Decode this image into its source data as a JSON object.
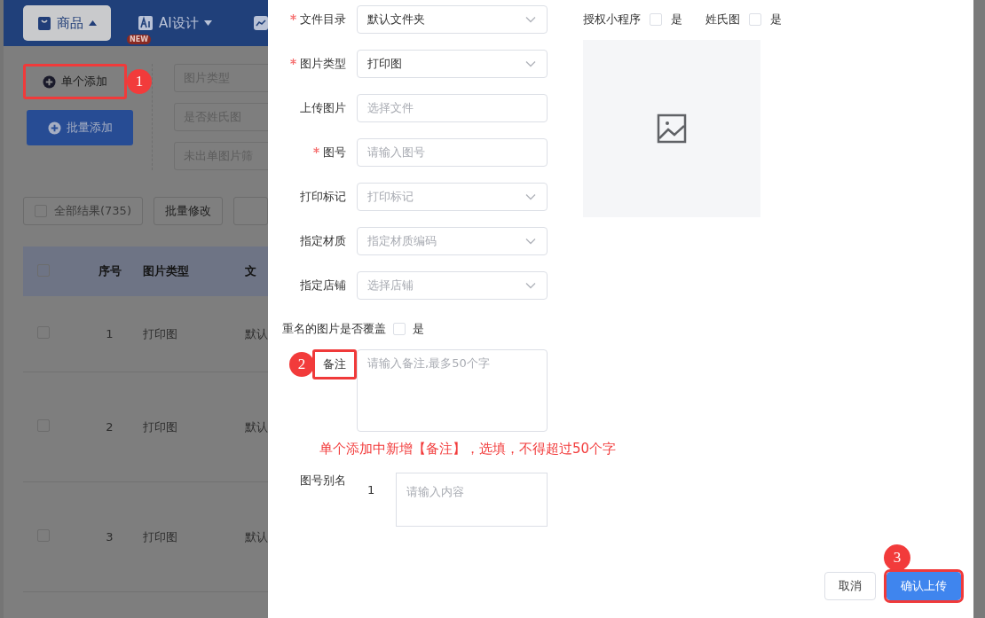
{
  "nav": {
    "tabs": [
      {
        "label": "商品",
        "kind": "bag",
        "selected": true
      },
      {
        "label": "AI设计",
        "kind": "ai",
        "badge": "NEW",
        "selected": false
      },
      {
        "kind": "chart",
        "selected": false
      }
    ]
  },
  "toolbar": {
    "add_single": {
      "label": "单个添加",
      "highlighted": true,
      "marker": "1"
    },
    "add_batch": {
      "label": "批量添加"
    }
  },
  "filters": [
    {
      "placeholder": "图片类型"
    },
    {
      "placeholder": "是否姓氏图"
    },
    {
      "placeholder": "未出单图片筛"
    }
  ],
  "actions": {
    "select_all": {
      "label": "全部结果(735)",
      "checked": false
    },
    "buttons": [
      "批量修改"
    ]
  },
  "table": {
    "header_checked": false,
    "columns": [
      "序号",
      "图片类型",
      "文"
    ],
    "rows": [
      {
        "checked": false,
        "cells": [
          "1",
          "打印图",
          "默认"
        ]
      },
      {
        "checked": false,
        "cells": [
          "2",
          "打印图",
          "默认"
        ]
      },
      {
        "checked": false,
        "cells": [
          "3",
          "打印图",
          "默认"
        ]
      }
    ]
  },
  "dialog": {
    "fields": [
      {
        "label": "文件目录",
        "required": true,
        "kind": "select",
        "value": "默认文件夹"
      },
      {
        "label": "图片类型",
        "required": true,
        "kind": "select",
        "value": "打印图"
      },
      {
        "label": "上传图片",
        "required": false,
        "kind": "input",
        "placeholder": "选择文件"
      },
      {
        "label": "图号",
        "required": true,
        "kind": "input",
        "placeholder": "请输入图号"
      },
      {
        "label": "打印标记",
        "required": false,
        "kind": "select",
        "placeholder": "打印标记"
      },
      {
        "label": "指定材质",
        "required": false,
        "kind": "select",
        "placeholder": "指定材质编码"
      },
      {
        "label": "指定店铺",
        "required": false,
        "kind": "select",
        "placeholder": "选择店铺"
      }
    ],
    "options": [
      {
        "label": "授权小程序",
        "checked": false,
        "text": "是"
      },
      {
        "label": "姓氏图",
        "checked": false,
        "text": "是"
      }
    ],
    "overwrite": {
      "label": "重名的图片是否覆盖",
      "checked": false,
      "text": "是"
    },
    "remark": {
      "label": "备注",
      "placeholder": "请输入备注,最多50个字",
      "highlighted": true,
      "marker": "2"
    },
    "note": "单个添加中新增【备注】，选填，不得超过50个字",
    "alias": {
      "label": "图号别名",
      "index": "1",
      "placeholder": "请输入内容"
    },
    "buttons": [
      {
        "label": "取消",
        "kind": "default",
        "highlighted": false
      },
      {
        "label": "确认上传",
        "kind": "primary",
        "highlighted": true,
        "marker": "3"
      }
    ]
  }
}
